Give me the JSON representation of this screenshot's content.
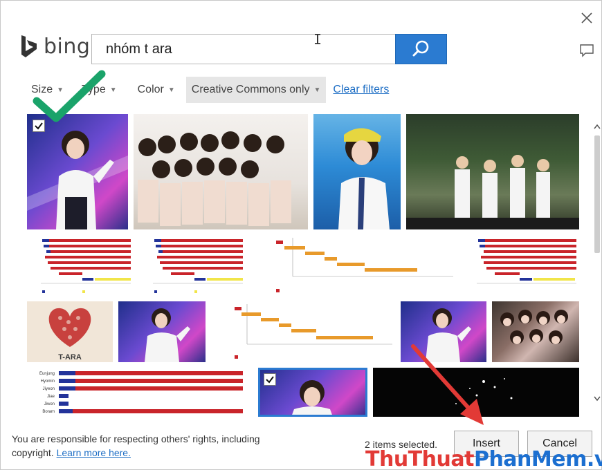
{
  "search": {
    "query": "nhóm t ara",
    "provider": "bing"
  },
  "filters": [
    {
      "label": "Size",
      "active": false
    },
    {
      "label": "Type",
      "active": false
    },
    {
      "label": "Color",
      "active": false
    },
    {
      "label": "Creative Commons only",
      "active": true
    }
  ],
  "clear_filters_label": "Clear filters",
  "results": [
    {
      "kind": "photo-stage",
      "selected": true
    },
    {
      "kind": "photo-group",
      "selected": false
    },
    {
      "kind": "photo-blue",
      "selected": false
    },
    {
      "kind": "photo-park",
      "selected": false
    },
    {
      "kind": "chart-bars",
      "selected": false
    },
    {
      "kind": "chart-bars",
      "selected": false
    },
    {
      "kind": "chart-gantt",
      "selected": false
    },
    {
      "kind": "chart-bars",
      "selected": false
    },
    {
      "kind": "heart-poster",
      "selected": false
    },
    {
      "kind": "photo-stage",
      "selected": false
    },
    {
      "kind": "chart-gantt",
      "selected": false
    },
    {
      "kind": "photo-stage",
      "selected": false
    },
    {
      "kind": "photo-poster",
      "selected": false
    },
    {
      "kind": "chart-bars-large",
      "selected": false
    },
    {
      "kind": "photo-stage",
      "selected": true
    },
    {
      "kind": "photo-dark",
      "selected": false
    }
  ],
  "thumb_texts": {
    "heart_caption": "T-ARA",
    "bar_names": [
      "Eunjung",
      "Hyomin",
      "Jiyeon",
      "Jiae",
      "Jiwon",
      "Boram"
    ]
  },
  "footer": {
    "notice": "You are responsible for respecting others' rights, including copyright.",
    "learn_more": "Learn more here.",
    "selected_count": "2 items selected.",
    "insert_label": "Insert",
    "cancel_label": "Cancel"
  },
  "watermark": {
    "part1": "ThuThuat",
    "part2": "PhanMem",
    "part3": ".vn"
  },
  "colors": {
    "accent": "#2b7bd1",
    "link": "#1f6fc5",
    "annotation_check": "#1aa36a",
    "annotation_arrow": "#e23a36",
    "watermark_red": "#e23a36",
    "watermark_blue": "#1c6fd0"
  }
}
